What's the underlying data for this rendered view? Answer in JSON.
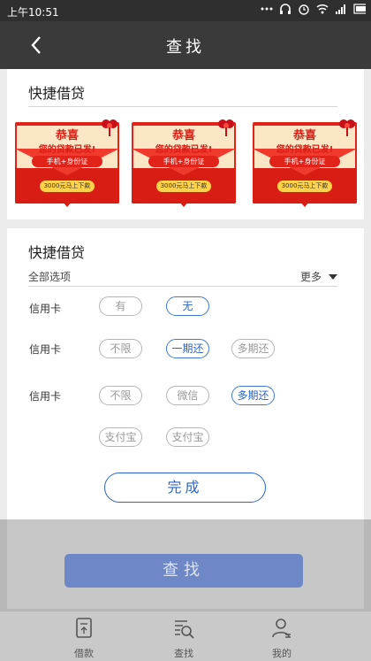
{
  "status_bar": {
    "time": "上午10:51",
    "icons": [
      "more-dots-icon",
      "headphones-icon",
      "alarm-icon",
      "wifi-icon",
      "signal-icon",
      "battery-icon"
    ]
  },
  "header": {
    "title": "查找",
    "back_icon": "chevron-left-icon"
  },
  "quick_loan_banner": {
    "title": "快捷借贷",
    "promos": [
      {
        "headline": "恭喜",
        "subtitle": "您的贷款已发!",
        "requirement": "手机+身份证",
        "amount": "3000元马上下款"
      },
      {
        "headline": "恭喜",
        "subtitle": "您的贷款已发!",
        "requirement": "手机+身份证",
        "amount": "3000元马上下款"
      },
      {
        "headline": "恭喜",
        "subtitle": "您的贷款已发!",
        "requirement": "手机+身份证",
        "amount": "3000元马上下款"
      }
    ]
  },
  "filter_panel": {
    "title": "快捷借贷",
    "all_options": "全部选项",
    "more": "更多",
    "rows": [
      {
        "label": "信用卡",
        "options": [
          {
            "text": "有",
            "selected": false
          },
          {
            "text": "无",
            "selected": true
          }
        ]
      },
      {
        "label": "信用卡",
        "options": [
          {
            "text": "不限",
            "selected": false
          },
          {
            "text": "一期还",
            "selected": true
          },
          {
            "text": "多期还",
            "selected": false
          }
        ]
      },
      {
        "label": "信用卡",
        "options": [
          {
            "text": "不限",
            "selected": false
          },
          {
            "text": "微信",
            "selected": false
          },
          {
            "text": "多期还",
            "selected": true
          },
          {
            "text": "支付宝",
            "selected": false
          },
          {
            "text": "支付宝",
            "selected": false
          }
        ]
      }
    ],
    "done_label": "完成"
  },
  "search_button": "查找",
  "bottom_nav": [
    {
      "label": "借款",
      "icon": "document-upload-icon"
    },
    {
      "label": "查找",
      "icon": "list-search-icon"
    },
    {
      "label": "我的",
      "icon": "user-icon"
    }
  ],
  "colors": {
    "accent": "#2b66c4",
    "search_button": "#6d87c7",
    "promo_red": "#e2231a",
    "title_bar": "#3a3a3a"
  }
}
